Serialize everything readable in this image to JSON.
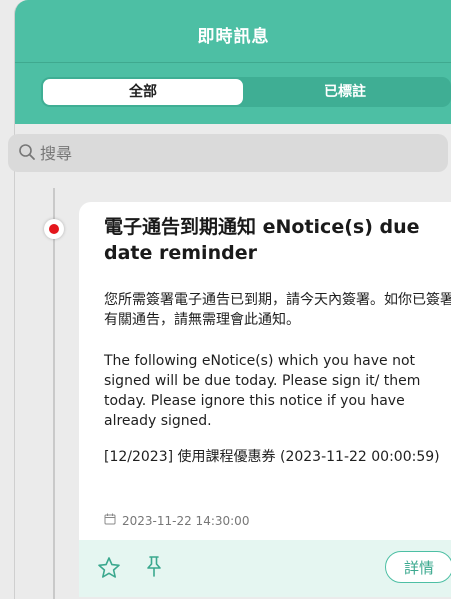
{
  "header": {
    "title": "即時訊息"
  },
  "tabs": [
    {
      "label": "全部",
      "active": true
    },
    {
      "label": "已標註",
      "active": false
    }
  ],
  "search": {
    "placeholder": "搜尋"
  },
  "notice": {
    "title": "電子通告到期通知 eNotice(s) due date reminder",
    "body_zh": "您所需簽署電子通告已到期，請今天內簽署。如你已簽署有關通告，請無需理會此通知。",
    "body_en": "The following eNotice(s)  which you have not signed will be due today. Please sign it/ them today. Please ignore this notice if you have already signed.",
    "item": "[12/2023] 使用課程優惠券 (2023-11-22 00:00:59)",
    "datetime": "2023-11-22 14:30:00",
    "details_label": "詳情",
    "unread": true
  },
  "colors": {
    "accent": "#4dbfa4",
    "unread_dot": "#e4161c",
    "action_bar": "#e5f6f1"
  },
  "icons": [
    "search-icon",
    "calendar-icon",
    "star-icon",
    "pin-icon"
  ]
}
